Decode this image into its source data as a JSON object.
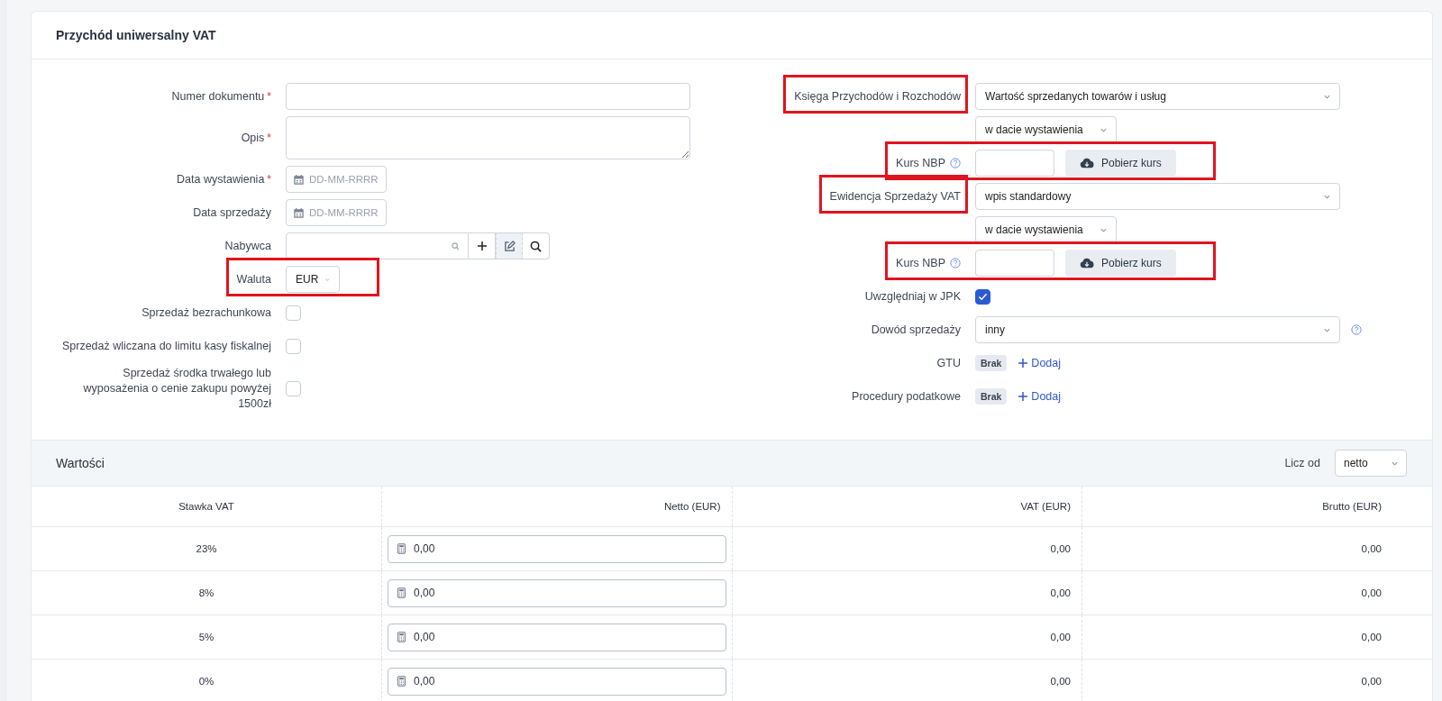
{
  "title": "Przychód uniwersalny VAT",
  "required_mark": "*",
  "left_fields": [
    {
      "kind": "text",
      "label": "Numer dokumentu",
      "required": true,
      "highlighted": false
    },
    {
      "kind": "textarea",
      "label": "Opis",
      "required": true,
      "highlighted": false
    },
    {
      "kind": "date",
      "label": "Data wystawienia",
      "required": true,
      "placeholder": "DD-MM-RRRR",
      "highlighted": false
    },
    {
      "kind": "date",
      "label": "Data sprzedaży",
      "required": false,
      "placeholder": "DD-MM-RRRR",
      "highlighted": false
    },
    {
      "kind": "lookup",
      "label": "Nabywca",
      "required": false,
      "highlighted": false
    },
    {
      "kind": "select",
      "label": "Waluta",
      "required": false,
      "value": "EUR",
      "highlighted": true
    },
    {
      "kind": "checkbox",
      "label": "Sprzedaż bezrachunkowa",
      "required": false,
      "checked": false,
      "highlighted": false
    },
    {
      "kind": "checkbox",
      "label": "Sprzedaż wliczana do limitu kasy fiskalnej",
      "required": false,
      "checked": false,
      "highlighted": false
    },
    {
      "kind": "checkbox",
      "label": "Sprzedaż środka trwałego lub wyposażenia o cenie zakupu powyżej 1500zł",
      "required": false,
      "checked": false,
      "highlighted": false
    }
  ],
  "right_fields": [
    {
      "kind": "select",
      "label": "Księga Przychodów i Rozchodów",
      "value": "Wartość sprzedanych towarów i usług",
      "help": false,
      "highlighted": true
    },
    {
      "kind": "select-small",
      "value": "w dacie wystawienia",
      "highlighted": false
    },
    {
      "kind": "rate",
      "label": "Kurs NBP",
      "button": "Pobierz kurs",
      "highlighted": true
    },
    {
      "kind": "select",
      "label": "Ewidencja Sprzedaży VAT",
      "value": "wpis standardowy",
      "help": false,
      "highlighted": true
    },
    {
      "kind": "select-small",
      "value": "w dacie wystawienia",
      "highlighted": false
    },
    {
      "kind": "rate",
      "label": "Kurs NBP",
      "button": "Pobierz kurs",
      "highlighted": true
    },
    {
      "kind": "checkbox",
      "label": "Uwzględniaj w JPK",
      "checked": true,
      "highlighted": false
    },
    {
      "kind": "select",
      "label": "Dowód sprzedaży",
      "value": "inny",
      "help": true,
      "highlighted": false
    },
    {
      "kind": "tags",
      "label": "GTU",
      "badge": "Brak",
      "link": "Dodaj",
      "highlighted": false
    },
    {
      "kind": "tags",
      "label": "Procedury podatkowe",
      "badge": "Brak",
      "link": "Dodaj",
      "highlighted": false
    }
  ],
  "values_section": {
    "title": "Wartości",
    "count_from": {
      "label": "Licz od",
      "value": "netto"
    },
    "columns": [
      "Stawka VAT",
      "Netto (EUR)",
      "VAT (EUR)",
      "Brutto (EUR)"
    ],
    "rows": [
      {
        "rate": "23%",
        "netto": "0,00",
        "vat": "0,00",
        "brutto": "0,00"
      },
      {
        "rate": "8%",
        "netto": "0,00",
        "vat": "0,00",
        "brutto": "0,00"
      },
      {
        "rate": "5%",
        "netto": "0,00",
        "vat": "0,00",
        "brutto": "0,00"
      },
      {
        "rate": "0%",
        "netto": "0,00",
        "vat": "0,00",
        "brutto": "0,00"
      }
    ]
  }
}
